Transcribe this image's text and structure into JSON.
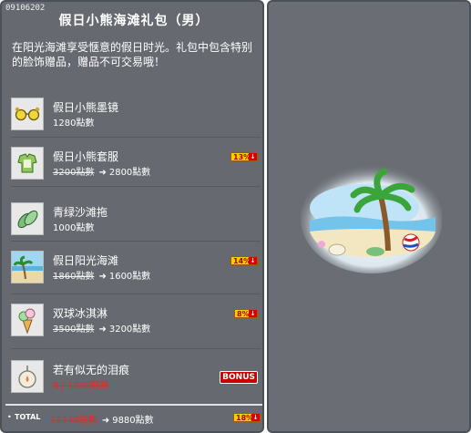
{
  "code": "09106202",
  "title": "假日小熊海滩礼包（男）",
  "description": "在阳光海滩享受惬意的假日时光。礼包中包含特别的脸饰赠品，赠品不可交易哦！",
  "items": [
    {
      "name": "假日小熊墨镜",
      "price": "1280點數"
    },
    {
      "name": "假日小熊套服",
      "old_price": "3200點數",
      "new_price": "2800點數",
      "badge": "13%"
    },
    {
      "name": "青绿沙滩拖",
      "price": "1000點數"
    },
    {
      "name": "假日阳光海滩",
      "old_price": "1860點數",
      "new_price": "1600點數",
      "badge": "14%"
    },
    {
      "name": "双球冰淇淋",
      "old_price": "3500點數",
      "new_price": "3200點數",
      "badge": "8%"
    },
    {
      "name": "若有似无的泪痕",
      "red_price": "0 / 1280點數",
      "bonus": "BONUS"
    }
  ],
  "total": {
    "label": "TOTAL",
    "old": "12140點數",
    "new": "9880點數",
    "badge": "18%"
  },
  "arrow": "➜",
  "down": "↓",
  "colors": {
    "panel": "#66696f",
    "badge": "#f7d000",
    "red": "#ff2020"
  }
}
